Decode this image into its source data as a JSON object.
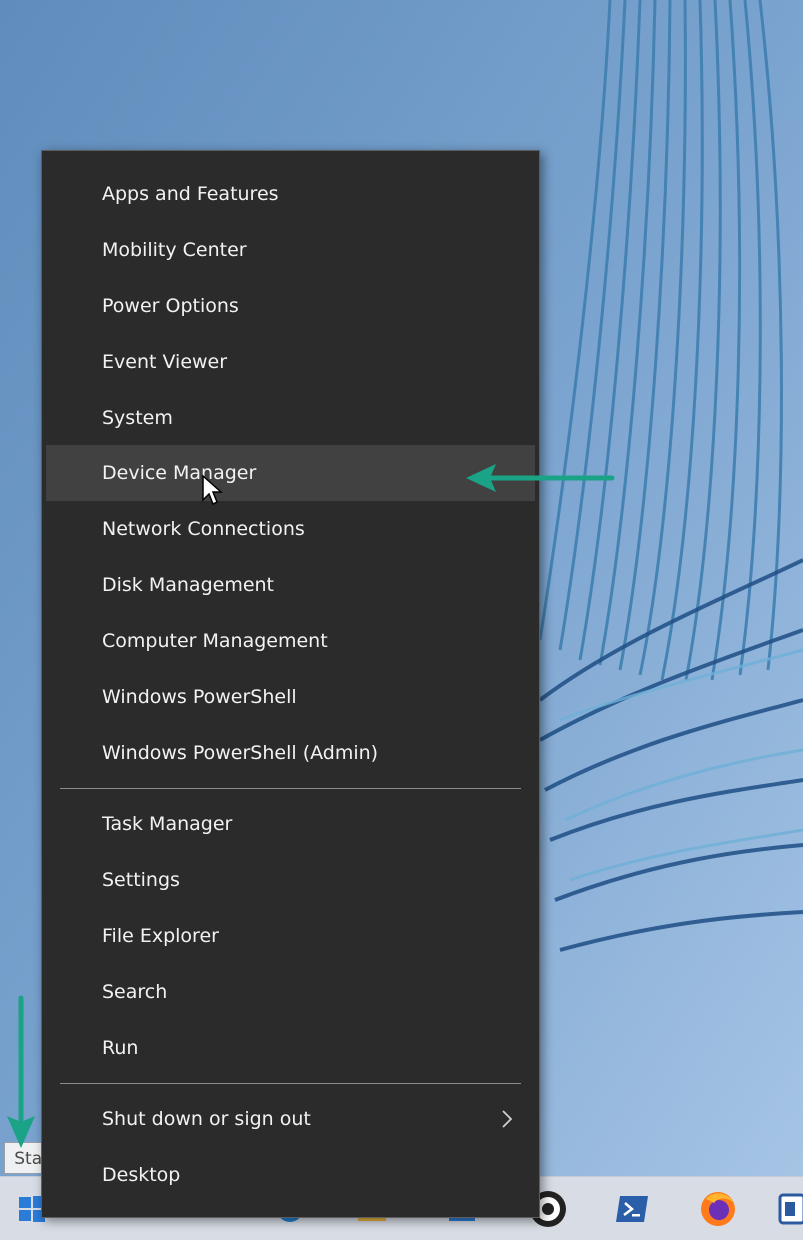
{
  "menu": {
    "group1": [
      {
        "label": "Apps and Features"
      },
      {
        "label": "Mobility Center"
      },
      {
        "label": "Power Options"
      },
      {
        "label": "Event Viewer"
      },
      {
        "label": "System"
      },
      {
        "label": "Device Manager",
        "hovered": true
      },
      {
        "label": "Network Connections"
      },
      {
        "label": "Disk Management"
      },
      {
        "label": "Computer Management"
      },
      {
        "label": "Windows PowerShell"
      },
      {
        "label": "Windows PowerShell (Admin)"
      }
    ],
    "group2": [
      {
        "label": "Task Manager"
      },
      {
        "label": "Settings"
      },
      {
        "label": "File Explorer"
      },
      {
        "label": "Search"
      },
      {
        "label": "Run"
      }
    ],
    "group3": [
      {
        "label": "Shut down or sign out",
        "submenu": true
      },
      {
        "label": "Desktop"
      }
    ]
  },
  "tooltip": {
    "label": "Start"
  },
  "colors": {
    "menu_bg": "#2b2b2b",
    "menu_hover": "#414141",
    "annotation_arrow": "#1aa386",
    "taskbar": "#d8dde5"
  },
  "taskbar": {
    "icons": [
      "windows-start-icon",
      "search-icon",
      "task-view-icon",
      "edge-icon",
      "file-explorer-icon",
      "store-icon",
      "obs-icon",
      "powershell-icon",
      "firefox-icon",
      "app-icon"
    ]
  }
}
